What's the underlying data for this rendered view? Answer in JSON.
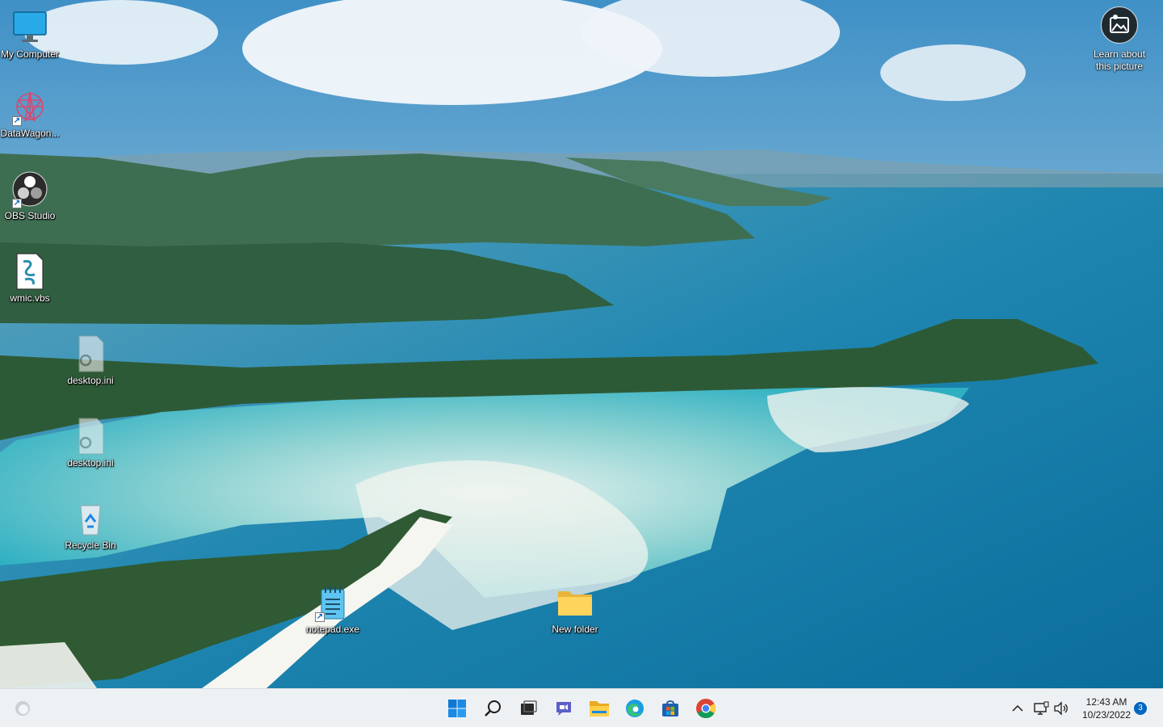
{
  "desktop": {
    "icons": [
      {
        "label": "My Computer",
        "icon": "monitor-icon"
      },
      {
        "label": "DataWagon...",
        "icon": "datawagon-icon"
      },
      {
        "label": "OBS Studio",
        "icon": "obs-icon"
      },
      {
        "label": "wmic.vbs",
        "icon": "script-file-icon"
      },
      {
        "label": "desktop.ini",
        "icon": "settings-file-icon"
      },
      {
        "label": "desktop.ini",
        "icon": "settings-file-icon"
      },
      {
        "label": "Recycle Bin",
        "icon": "recycle-bin-icon"
      },
      {
        "label": "notepad.exe",
        "icon": "notepad-icon"
      },
      {
        "label": "New folder",
        "icon": "folder-icon"
      }
    ],
    "learn_about": {
      "label": "Learn about this picture",
      "icon": "picture-info-icon"
    }
  },
  "taskbar": {
    "apps": [
      {
        "name": "Start",
        "icon": "windows-start-icon"
      },
      {
        "name": "Search",
        "icon": "search-icon"
      },
      {
        "name": "Task View",
        "icon": "task-view-icon"
      },
      {
        "name": "Chat",
        "icon": "chat-icon"
      },
      {
        "name": "File Explorer",
        "icon": "file-explorer-icon"
      },
      {
        "name": "Microsoft Edge",
        "icon": "edge-icon"
      },
      {
        "name": "Microsoft Store",
        "icon": "store-icon"
      },
      {
        "name": "Google Chrome",
        "icon": "chrome-icon"
      }
    ],
    "tray": {
      "time": "12:43 AM",
      "date": "10/23/2022",
      "notification_count": "3"
    }
  },
  "colors": {
    "accent": "#0067c0",
    "taskbar": "#eef1f4"
  }
}
